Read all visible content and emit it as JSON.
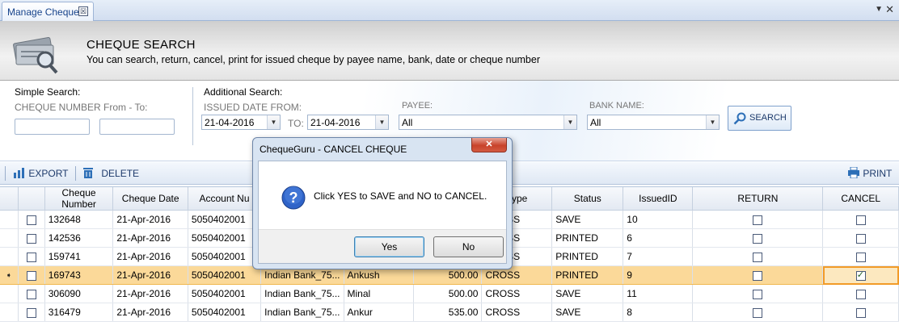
{
  "tab": {
    "title": "Manage Cheque",
    "close_glyph": "☒",
    "menu_glyph": "▼",
    "x_glyph": "✕"
  },
  "header": {
    "title": "CHEQUE SEARCH",
    "subtitle": "You can search, return, cancel, print for issued cheque by payee name, bank, date or cheque number"
  },
  "search": {
    "simple_label": "Simple Search:",
    "cheque_range_label": "CHEQUE NUMBER From - To:",
    "from_value": "",
    "to_value": "",
    "additional_label": "Additional Search:",
    "issued_from_label": "ISSUED DATE FROM:",
    "issued_from_value": "21-04-2016",
    "to_label": "TO:",
    "issued_to_value": "21-04-2016",
    "payee_label": "PAYEE:",
    "payee_value": "All",
    "bank_label": "BANK NAME:",
    "bank_value": "All",
    "search_button": "SEARCH"
  },
  "toolbar": {
    "export": "EXPORT",
    "delete": "DELETE",
    "print": "PRINT"
  },
  "grid": {
    "columns": [
      "Cheque Number",
      "Cheque Date",
      "Account Nu",
      "",
      "",
      "",
      "Type",
      "Status",
      "IssuedID",
      "RETURN",
      "CANCEL"
    ],
    "rows": [
      {
        "indicator": "",
        "cheque_number": "132648",
        "date": "21-Apr-2016",
        "account": "5050402001",
        "bank": "",
        "payee": "",
        "amount": "",
        "type": "CROSS",
        "status": "SAVE",
        "issued_id": "10",
        "return": false,
        "cancel": false,
        "selected": false
      },
      {
        "indicator": "",
        "cheque_number": "142536",
        "date": "21-Apr-2016",
        "account": "5050402001",
        "bank": "",
        "payee": "",
        "amount": "",
        "type": "CROSS",
        "status": "PRINTED",
        "issued_id": "6",
        "return": false,
        "cancel": false,
        "selected": false
      },
      {
        "indicator": "",
        "cheque_number": "159741",
        "date": "21-Apr-2016",
        "account": "5050402001",
        "bank": "",
        "payee": "",
        "amount": "",
        "type": "CROSS",
        "status": "PRINTED",
        "issued_id": "7",
        "return": false,
        "cancel": false,
        "selected": false
      },
      {
        "indicator": "➧",
        "cheque_number": "169743",
        "date": "21-Apr-2016",
        "account": "5050402001",
        "bank": "Indian Bank_75...",
        "payee": "Ankush",
        "amount": "500.00",
        "type": "CROSS",
        "status": "PRINTED",
        "issued_id": "9",
        "return": false,
        "cancel": true,
        "selected": true
      },
      {
        "indicator": "",
        "cheque_number": "306090",
        "date": "21-Apr-2016",
        "account": "5050402001",
        "bank": "Indian Bank_75...",
        "payee": "Minal",
        "amount": "500.00",
        "type": "CROSS",
        "status": "SAVE",
        "issued_id": "11",
        "return": false,
        "cancel": false,
        "selected": false
      },
      {
        "indicator": "",
        "cheque_number": "316479",
        "date": "21-Apr-2016",
        "account": "5050402001",
        "bank": "Indian Bank_75...",
        "payee": "Ankur",
        "amount": "535.00",
        "type": "CROSS",
        "status": "SAVE",
        "issued_id": "8",
        "return": false,
        "cancel": false,
        "selected": false
      }
    ]
  },
  "dialog": {
    "title": "ChequeGuru - CANCEL CHEQUE",
    "close_glyph": "✕",
    "message": "Click YES to SAVE and NO to CANCEL.",
    "icon_glyph": "?",
    "yes_label": "Yes",
    "no_label": "No"
  },
  "colors": {
    "accent": "#15428b",
    "selected_row": "#fbd999",
    "active_cell_border": "#f29b28",
    "dialog_close": "#c8422a"
  }
}
